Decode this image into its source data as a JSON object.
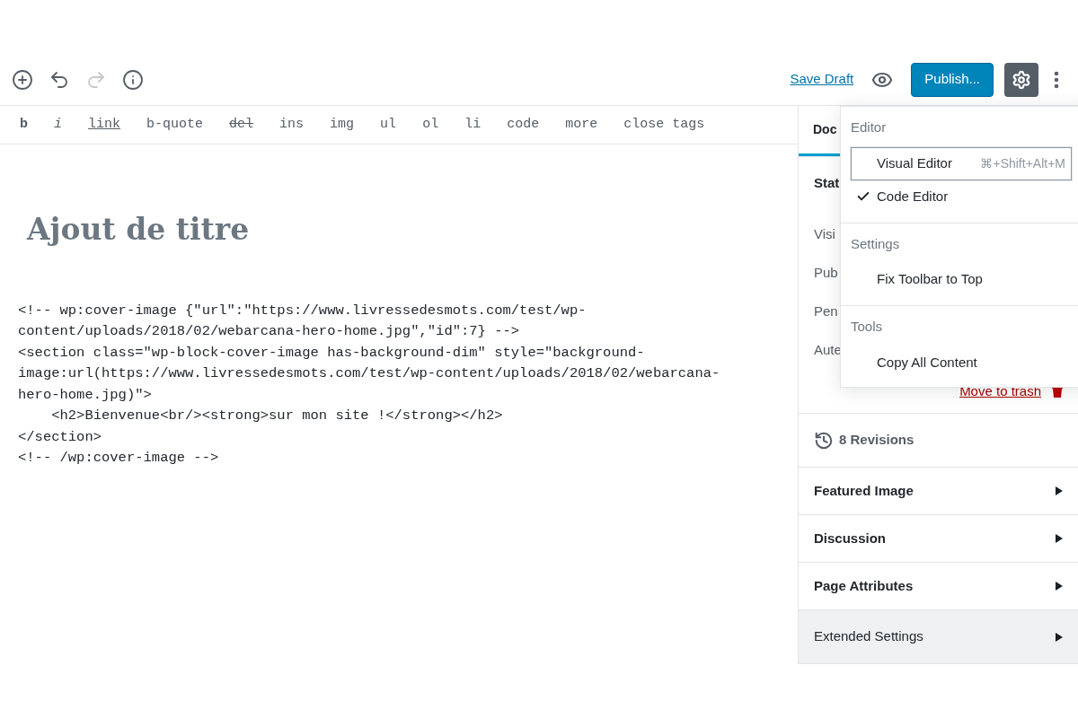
{
  "header": {
    "tools": [
      {
        "kind": "add",
        "disabled": false
      },
      {
        "kind": "undo",
        "disabled": false
      },
      {
        "kind": "redo",
        "disabled": true
      },
      {
        "kind": "info",
        "disabled": false
      }
    ],
    "save_draft": "Save Draft",
    "publish": "Publish...",
    "settings_active": true
  },
  "format_toolbar": [
    {
      "label": "b",
      "kind": "bold"
    },
    {
      "label": "i",
      "kind": "italic"
    },
    {
      "label": "link",
      "kind": "underline"
    },
    {
      "label": "b-quote",
      "kind": "plain"
    },
    {
      "label": "del",
      "kind": "strike"
    },
    {
      "label": "ins",
      "kind": "plain"
    },
    {
      "label": "img",
      "kind": "plain"
    },
    {
      "label": "ul",
      "kind": "plain"
    },
    {
      "label": "ol",
      "kind": "plain"
    },
    {
      "label": "li",
      "kind": "plain"
    },
    {
      "label": "code",
      "kind": "plain"
    },
    {
      "label": "more",
      "kind": "plain"
    },
    {
      "label": "close tags",
      "kind": "plain"
    }
  ],
  "editor": {
    "title": "Ajout de titre",
    "code_lines": [
      "<!-- wp:cover-image {\"url\":\"https://www.livressedesmots.com/test/wp-",
      "content/uploads/2018/02/webarcana-hero-home.jpg\",\"id\":7} -->",
      "<section class=\"wp-block-cover-image has-background-dim\" style=\"background-",
      "image:url(https://www.livressedesmots.com/test/wp-content/uploads/2018/02/webarcana-",
      "hero-home.jpg)\">",
      "    <h2>Bienvenue<br/><strong>sur mon site !</strong></h2>",
      "</section>",
      "<!-- /wp:cover-image -->"
    ]
  },
  "sidebar": {
    "tab": {
      "label": "Doc",
      "selected": true
    },
    "status_heading": "Stat",
    "status_rows": [
      "Visi",
      "Pub",
      "Pen",
      "Aute"
    ],
    "move_to_trash": "Move to trash",
    "revisions": "8 Revisions",
    "panels": [
      {
        "label": "Featured Image",
        "highlighted": false
      },
      {
        "label": "Discussion",
        "highlighted": false
      },
      {
        "label": "Page Attributes",
        "highlighted": false
      },
      {
        "label": "Extended Settings",
        "highlighted": true
      }
    ]
  },
  "menu": {
    "sections": [
      {
        "heading": "Editor",
        "items": [
          {
            "label": "Visual Editor",
            "shortcut": "⌘+Shift+Alt+M",
            "checked": false,
            "focused": true
          },
          {
            "label": "Code Editor",
            "checked": true,
            "focused": false
          }
        ]
      },
      {
        "heading": "Settings",
        "items": [
          {
            "label": "Fix Toolbar to Top",
            "checked": false,
            "focused": false
          }
        ]
      },
      {
        "heading": "Tools",
        "items": [
          {
            "label": "Copy All Content",
            "checked": false,
            "focused": false
          }
        ]
      }
    ]
  }
}
